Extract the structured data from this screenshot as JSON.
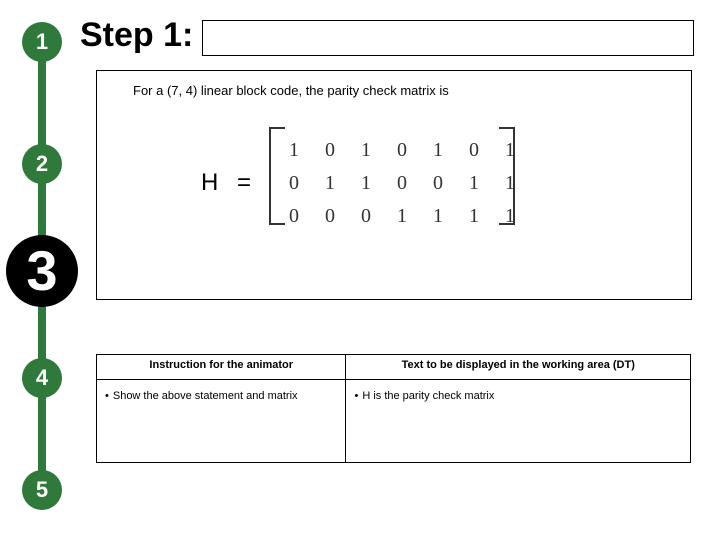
{
  "heading": "Step 1:",
  "steps": {
    "s1": "1",
    "s2": "2",
    "s3": "3",
    "s4": "4",
    "s5": "5"
  },
  "content": {
    "intro": "For a (7, 4) linear block code, the parity check matrix is",
    "matrix_label": "H ="
  },
  "chart_data": {
    "type": "table",
    "title": "Parity check matrix H for (7,4) linear block code",
    "rows": [
      [
        1,
        0,
        1,
        0,
        1,
        0,
        1
      ],
      [
        0,
        1,
        1,
        0,
        0,
        1,
        1
      ],
      [
        0,
        0,
        0,
        1,
        1,
        1,
        1
      ]
    ]
  },
  "table": {
    "head_left": "Instruction for the animator",
    "head_right": "Text to be displayed in the working area (DT)",
    "cell_left": "Show the above statement and matrix",
    "cell_right": "H is the parity check matrix"
  },
  "bullet": "•"
}
